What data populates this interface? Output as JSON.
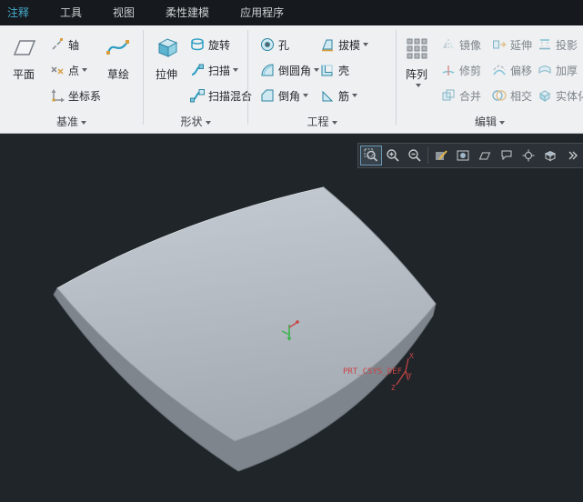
{
  "menubar": {
    "items": [
      {
        "label": "注释",
        "accent": true
      },
      {
        "label": "工具",
        "accent": false
      },
      {
        "label": "视图",
        "accent": false
      },
      {
        "label": "柔性建模",
        "accent": false
      },
      {
        "label": "应用程序",
        "accent": false
      }
    ]
  },
  "ribbon": {
    "groups": [
      {
        "label": "基准",
        "items": [
          {
            "label": "平面",
            "type": "large"
          },
          {
            "label": "轴"
          },
          {
            "label": "点",
            "dropdown": true
          },
          {
            "label": "坐标系"
          },
          {
            "label": "草绘",
            "type": "large"
          }
        ]
      },
      {
        "label": "形状",
        "items": [
          {
            "label": "拉伸",
            "type": "large"
          },
          {
            "label": "旋转"
          },
          {
            "label": "扫描",
            "dropdown": true
          },
          {
            "label": "扫描混合"
          }
        ]
      },
      {
        "label": "工程",
        "items": [
          {
            "label": "孔"
          },
          {
            "label": "倒圆角",
            "dropdown": true
          },
          {
            "label": "倒角",
            "dropdown": true
          },
          {
            "label": "拔模",
            "dropdown": true
          },
          {
            "label": "壳"
          },
          {
            "label": "筋",
            "dropdown": true
          }
        ]
      },
      {
        "label": "编辑",
        "items": [
          {
            "label": "阵列",
            "type": "large",
            "dropdown": true
          },
          {
            "label": "镜像",
            "disabled": true
          },
          {
            "label": "修剪",
            "disabled": true
          },
          {
            "label": "合并",
            "disabled": true
          },
          {
            "label": "延伸",
            "disabled": true
          },
          {
            "label": "偏移",
            "disabled": true
          },
          {
            "label": "相交",
            "disabled": true
          },
          {
            "label": "投影",
            "disabled": true
          },
          {
            "label": "加厚",
            "disabled": true
          },
          {
            "label": "实体化",
            "disabled": true
          }
        ]
      }
    ]
  },
  "viewport_toolbar": {
    "icons": [
      "zoom-window",
      "zoom-in",
      "zoom-out",
      "repaint",
      "display-style",
      "datum-display",
      "annotation-display",
      "spin-center",
      "view-manager",
      "overflow"
    ]
  },
  "viewport": {
    "csys_label": "PRT_CSYS_DEF",
    "axis_x": "X",
    "axis_y": "Y",
    "axis_z": "Z"
  },
  "colors": {
    "menubar_bg": "#16191d",
    "accent": "#45abcb",
    "ribbon_bg": "#eef0f2",
    "viewport_bg": "#20252a",
    "csys_red": "#c94545",
    "csys_green": "#38b44a",
    "icon_teal": "#2e9fc2"
  }
}
